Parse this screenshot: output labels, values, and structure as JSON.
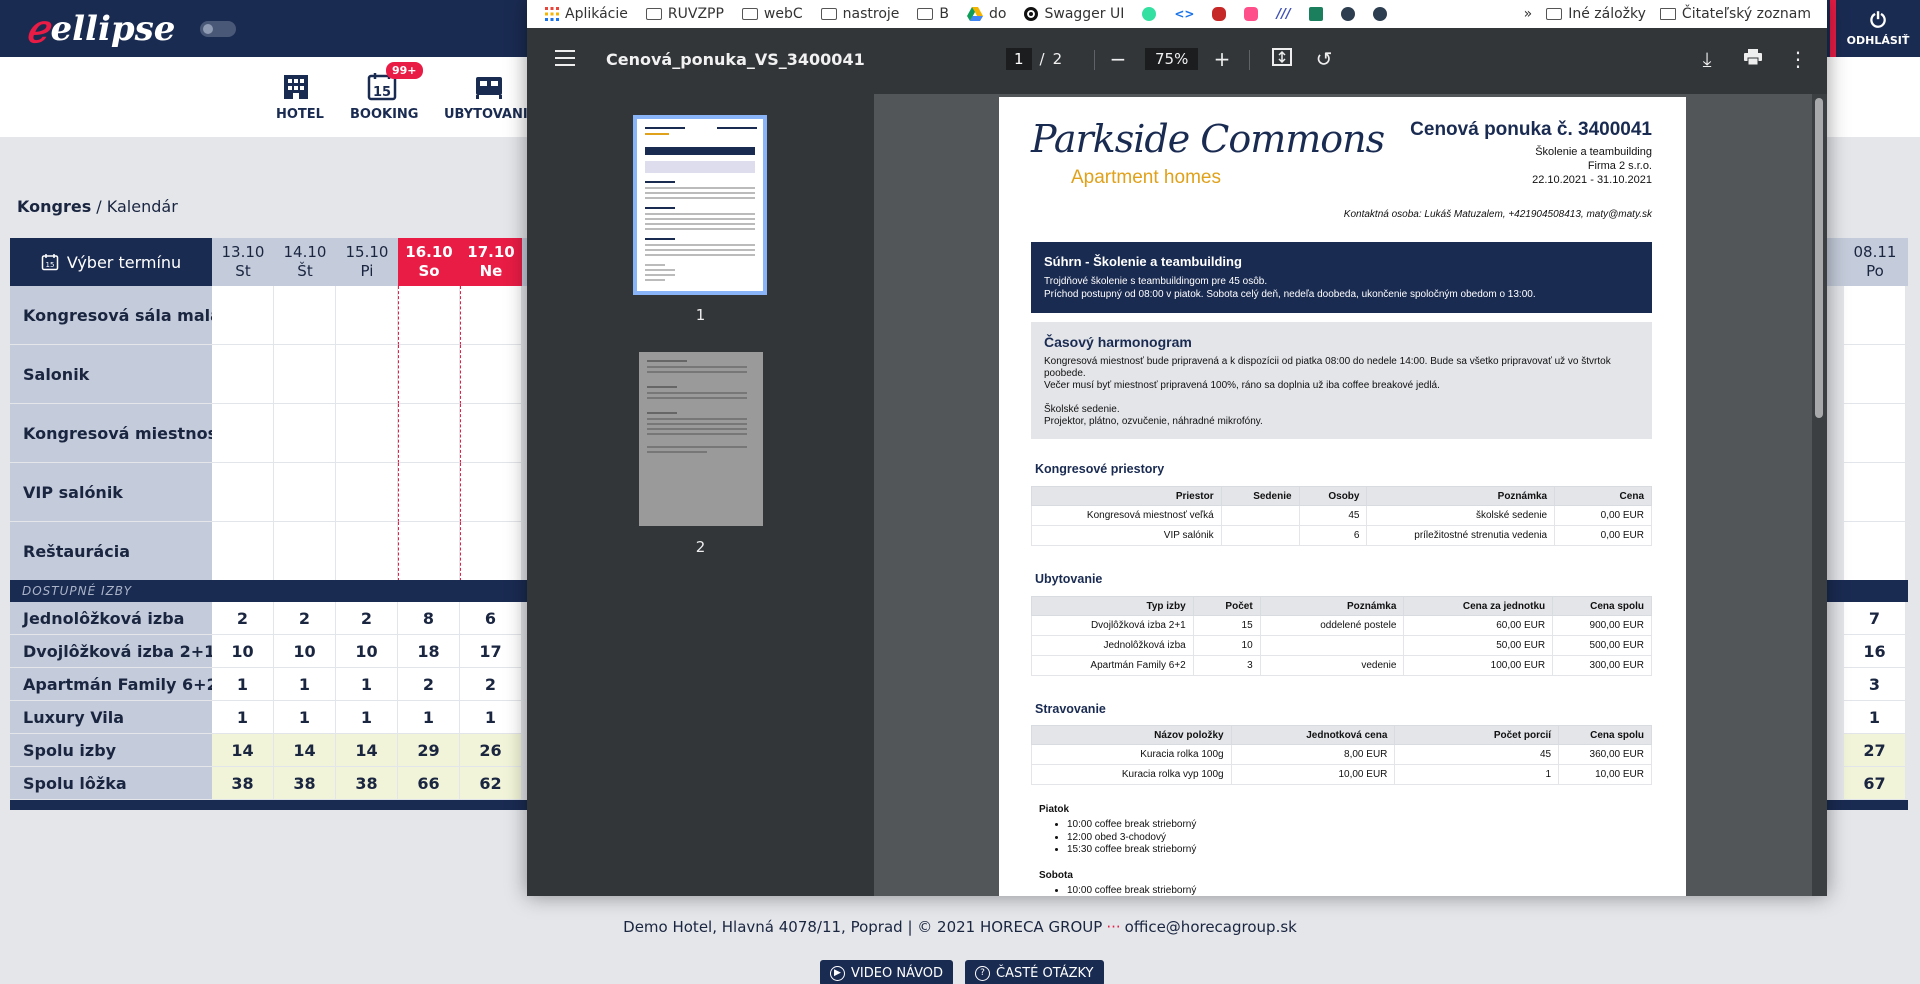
{
  "app": {
    "logo": "ellipse",
    "logout_label": "ODHLÁSIŤ"
  },
  "nav": {
    "items": [
      {
        "label": "HOTEL"
      },
      {
        "label": "BOOKING",
        "badge": "99+",
        "icon_day": "15"
      },
      {
        "label": "UBYTOVANIE"
      }
    ]
  },
  "breadcrumb": {
    "root": "Kongres",
    "current": "Kalendár",
    "sep": " / "
  },
  "calendar": {
    "select_label": "Výber termínu",
    "dates": [
      {
        "date": "13.10",
        "day": "St",
        "weekend": false
      },
      {
        "date": "14.10",
        "day": "Št",
        "weekend": false
      },
      {
        "date": "15.10",
        "day": "Pi",
        "weekend": false
      },
      {
        "date": "16.10",
        "day": "So",
        "weekend": true
      },
      {
        "date": "17.10",
        "day": "Ne",
        "weekend": true
      }
    ],
    "right_date": {
      "date": "08.11",
      "day": "Po"
    },
    "rooms": [
      "Kongresová sála malá",
      "Salonik",
      "Kongresová miestnosť ...",
      "VIP salónik",
      "Reštaurácia"
    ],
    "available_label": "DOSTUPNÉ IZBY",
    "avail_rows": [
      {
        "label": "Jednolôžková izba",
        "values": [
          "2",
          "2",
          "2",
          "8",
          "6"
        ],
        "right": "7",
        "total": false
      },
      {
        "label": "Dvojlôžková izba 2+1",
        "values": [
          "10",
          "10",
          "10",
          "18",
          "17"
        ],
        "right": "16",
        "total": false
      },
      {
        "label": "Apartmán Family 6+2",
        "values": [
          "1",
          "1",
          "1",
          "2",
          "2"
        ],
        "right": "3",
        "total": false
      },
      {
        "label": "Luxury Vila",
        "values": [
          "1",
          "1",
          "1",
          "1",
          "1"
        ],
        "right": "1",
        "total": false
      },
      {
        "label": "Spolu izby",
        "values": [
          "14",
          "14",
          "14",
          "29",
          "26"
        ],
        "right": "27",
        "total": true
      },
      {
        "label": "Spolu lôžka",
        "values": [
          "38",
          "38",
          "38",
          "66",
          "62"
        ],
        "right": "67",
        "total": true
      }
    ]
  },
  "footer": {
    "address": "Demo Hotel, Hlavná 4078/11, Poprad | © 2021 HORECA GROUP",
    "dots": "···",
    "email": "office@horecagroup.sk",
    "btn_video": "VIDEO NÁVOD",
    "btn_faq": "ČASTÉ OTÁZKY"
  },
  "bookmarks": {
    "items": [
      "Aplikácie",
      "RUVZPP",
      "webC",
      "nastroje",
      "B",
      "do",
      "Swagger UI"
    ],
    "more": "»",
    "other": "Iné záložky",
    "reading": "Čitateľský zoznam"
  },
  "pdf": {
    "filename": "Cenová_ponuka_VS_3400041",
    "page_current": "1",
    "page_sep": "/",
    "page_total": "2",
    "zoom": "75%",
    "thumb1_num": "1",
    "thumb2_num": "2",
    "doc": {
      "logo_main": "Parkside Commons",
      "logo_sub": "Apartment homes",
      "title": "Cenová ponuka č. 3400041",
      "subtitle": "Školenie a teambuilding",
      "company": "Firma 2 s.r.o.",
      "period": "22.10.2021 - 31.10.2021",
      "contact": "Kontaktná osoba: Lukáš Matuzalem, +421904508413, maty@maty.sk",
      "summary_title": "Súhrn - Školenie a teambuilding",
      "summary_lines": [
        "Trojdňové školenie s teambuildingom pre 45 osôb.",
        "Príchod postupný od 08:00 v piatok. Sobota celý deň, nedeľa doobeda, ukončenie spoločným obedom o 13:00."
      ],
      "harm_title": "Časový harmonogram",
      "harm_lines": [
        "Kongresová miestnosť bude pripravená a k dispozícii od piatka 08:00 do nedele 14:00. Bude sa všetko pripravovať už vo štvrtok poobede.",
        "Večer musí byť miestnosť pripravená 100%, ráno sa doplnia už iba coffee breakové jedlá.",
        "",
        "Školské sedenie.",
        "Projektor, plátno, ozvučenie, náhradné mikrofóny."
      ],
      "kong_title": "Kongresové priestory",
      "kong_headers": [
        "Priestor",
        "Sedenie",
        "Osoby",
        "Poznámka",
        "Cena"
      ],
      "kong_rows": [
        [
          "Kongresová miestnosť veľká",
          "",
          "45",
          "školské sedenie",
          "0,00 EUR"
        ],
        [
          "VIP salónik",
          "",
          "6",
          "príležitostné strenutia vedenia",
          "0,00 EUR"
        ]
      ],
      "ub_title": "Ubytovanie",
      "ub_headers": [
        "Typ izby",
        "Počet",
        "Poznámka",
        "Cena za jednotku",
        "Cena spolu"
      ],
      "ub_rows": [
        [
          "Dvojlôžková izba 2+1",
          "15",
          "oddelené postele",
          "60,00 EUR",
          "900,00 EUR"
        ],
        [
          "Jednolôžková izba",
          "10",
          "",
          "50,00 EUR",
          "500,00 EUR"
        ],
        [
          "Apartmán Family 6+2",
          "3",
          "vedenie",
          "100,00 EUR",
          "300,00 EUR"
        ]
      ],
      "st_title": "Stravovanie",
      "st_headers": [
        "Názov položky",
        "Jednotková cena",
        "Počet porcií",
        "Cena spolu"
      ],
      "st_rows": [
        [
          "Kuracia rolka 100g",
          "8,00 EUR",
          "45",
          "360,00 EUR"
        ],
        [
          "Kuracia rolka vyp 100g",
          "10,00 EUR",
          "1",
          "10,00 EUR"
        ]
      ],
      "day1": "Piatok",
      "day1_items": [
        "10:00 coffee break strieborný",
        "12:00 obed 3-chodový",
        "15:30 coffee break strieborný"
      ],
      "day2": "Sobota",
      "day2_items": [
        "10:00 coffee break strieborný"
      ]
    }
  },
  "colors": {
    "navy": "#1a2b52",
    "accent": "#e81c45",
    "gold": "#e0a11b"
  }
}
